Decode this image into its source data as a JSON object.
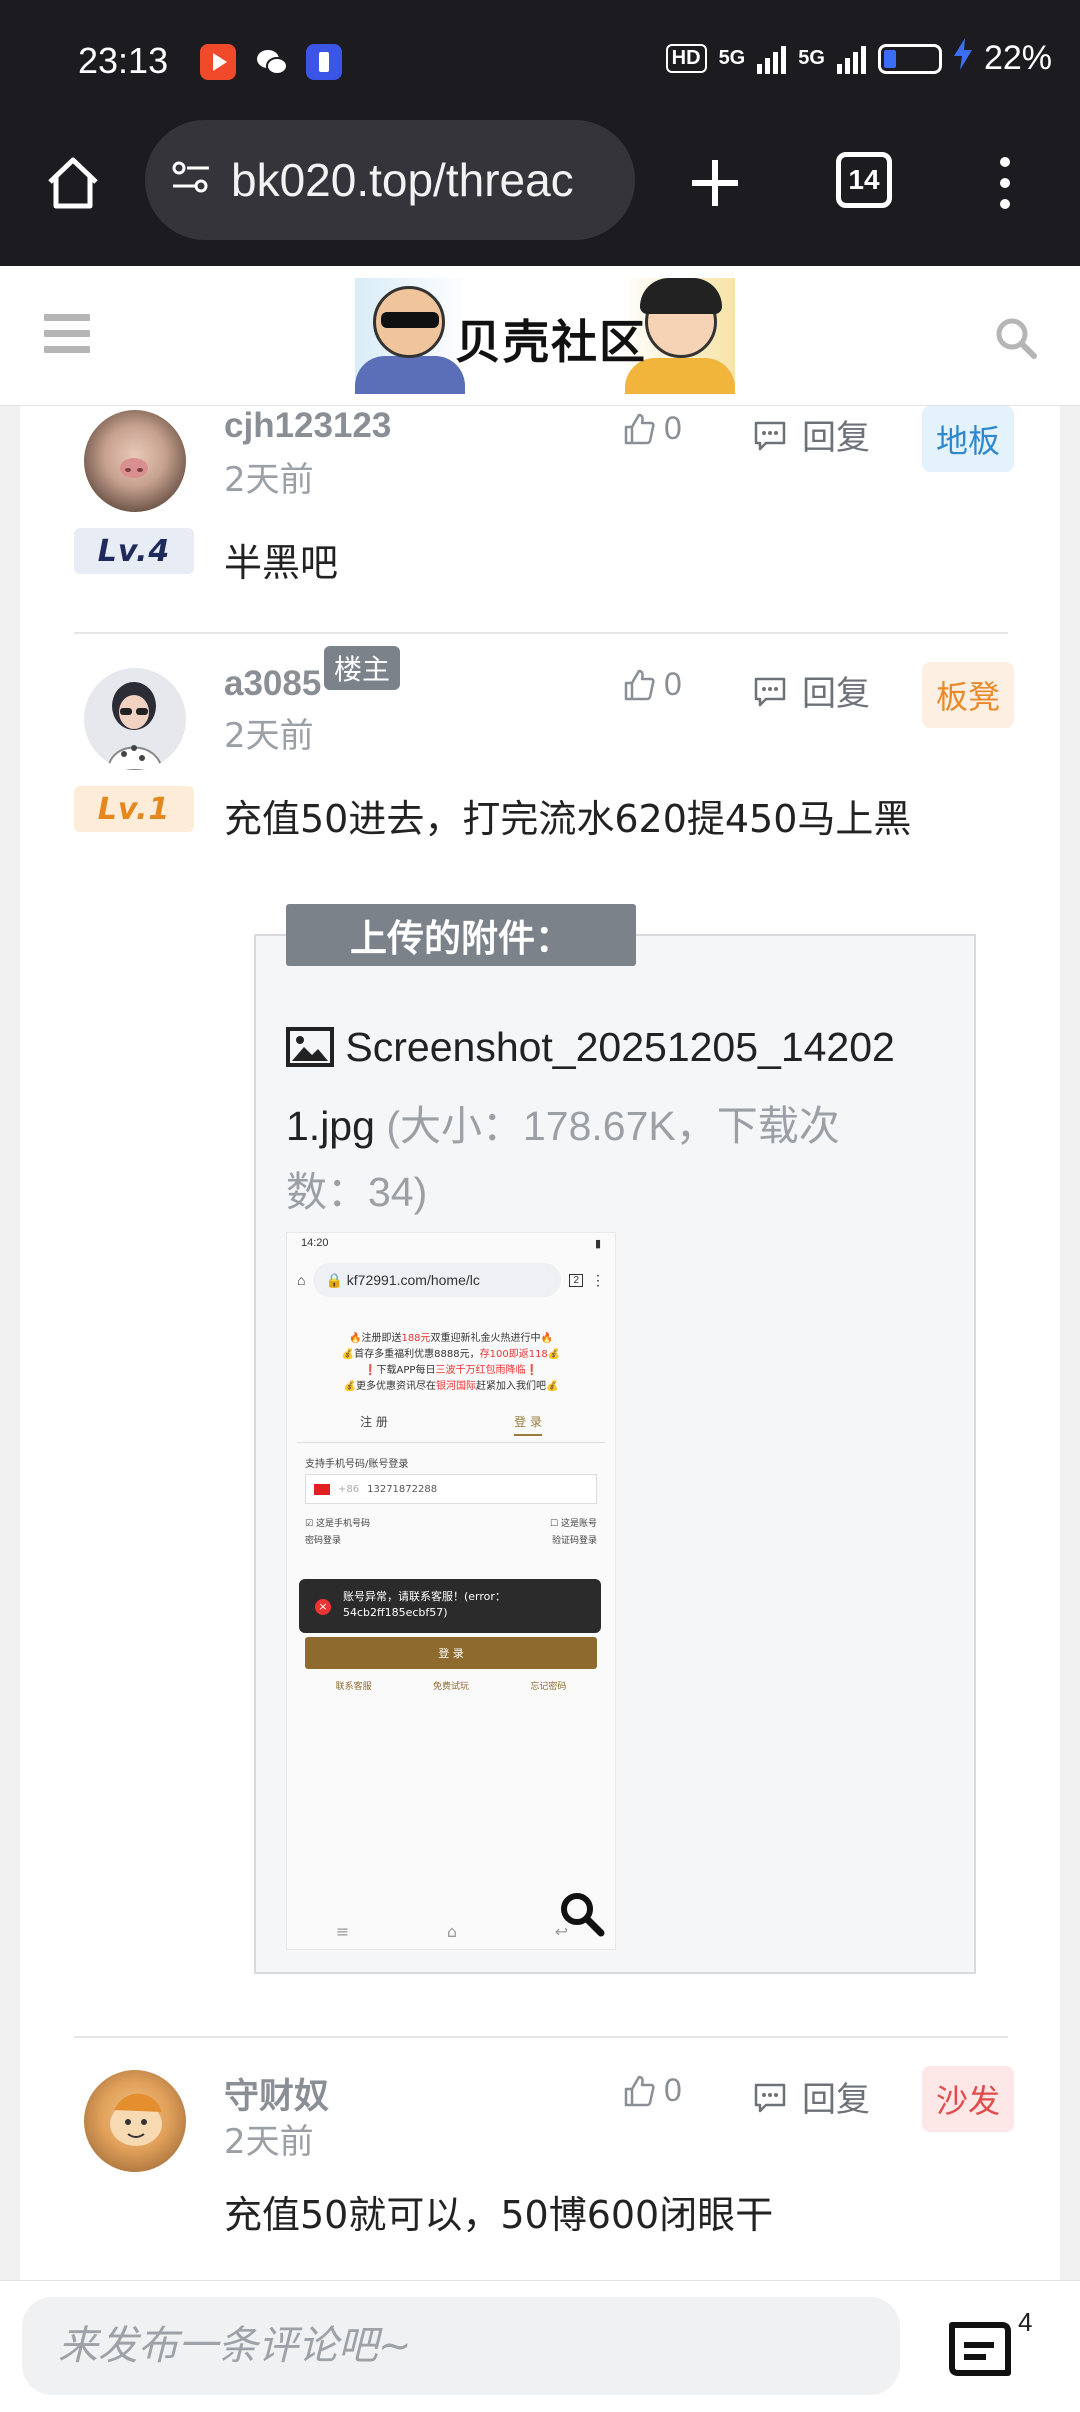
{
  "status_bar": {
    "time": "23:13",
    "hd": "HD",
    "network1": "5G",
    "network2": "5G",
    "battery": "22%"
  },
  "browser": {
    "url": "bk020.top/threac",
    "tab_count": "14"
  },
  "site": {
    "logo_text": "贝壳社区"
  },
  "posts": [
    {
      "username": "cjh123123",
      "time": "2天前",
      "level": "Lv.4",
      "likes": "0",
      "reply_label": "回复",
      "floor": "地板",
      "body": "半黑吧"
    },
    {
      "username": "a3085",
      "owner_badge": "楼主",
      "time": "2天前",
      "level": "Lv.1",
      "likes": "0",
      "reply_label": "回复",
      "floor": "板凳",
      "body": "充值50进去，打完流水620提450马上黑",
      "attachment": {
        "title": "上传的附件：",
        "file_line1": "Screenshot_20251205_14202",
        "file_line2": "1.jpg",
        "meta_line2": "(大小：178.67K，下载次",
        "meta_line3": "数：34)"
      }
    },
    {
      "username": "守财奴",
      "time": "2天前",
      "likes": "0",
      "reply_label": "回复",
      "floor": "沙发",
      "body": "充值50就可以，50博600闭眼干"
    }
  ],
  "thumbnail": {
    "status_time": "14:20",
    "url": "kf72991.com/home/lc",
    "tab_count": "2",
    "promo_1a": "🔥注册即送",
    "promo_1b": "188元",
    "promo_1c": "双重迎新礼金火热进行中🔥",
    "promo_2a": "💰首存多重福利优惠8888元，",
    "promo_2b": "存100即返118",
    "promo_2c": "💰",
    "promo_3a": "❗下载APP每日",
    "promo_3b": "三波千万红包雨降临",
    "promo_3c": "❗",
    "promo_4a": "💰更多优惠资讯尽在",
    "promo_4b": "银河国际",
    "promo_4c": "赶紧加入我们吧💰",
    "tab_register": "注 册",
    "tab_login": "登 录",
    "field_label": "支持手机号码/账号登录",
    "country_code": "+86",
    "phone": "13271872288",
    "check_phone": "这是手机号码",
    "check_account": "这是账号",
    "pwd_login": "密码登录",
    "forgot_login": "验证码登录",
    "toast_line1": "账号异常，请联系客服！(error：",
    "toast_line2": "54cb2ff185ecbf57)",
    "login_btn": "登 录",
    "link_service": "联系客服",
    "link_trial": "免费试玩",
    "link_forgot": "忘记密码"
  },
  "bottom": {
    "comment_placeholder": "来发布一条评论吧~",
    "comment_count": "4"
  },
  "colors": {
    "status_bg": "#1c1c20",
    "floor_blue": "#2f88cf",
    "floor_orange": "#e9892a",
    "floor_red": "#e34b4b",
    "attach_title_bg": "#7b8289"
  }
}
